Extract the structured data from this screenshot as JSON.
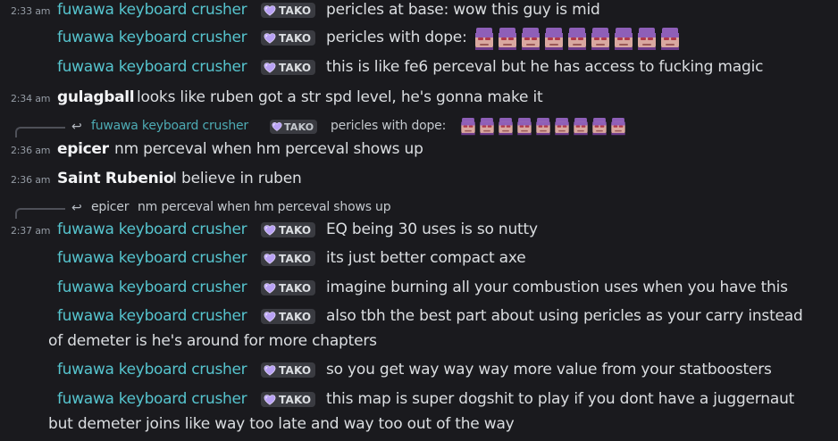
{
  "colors": {
    "background": "#1a1a1e",
    "username_teal": "#56c4ce",
    "username_white": "#f2f3f5",
    "text": "#dbdee1",
    "timestamp": "#949ba4",
    "tag_bg": "#3a3b41",
    "heart": "#b9a2f5"
  },
  "tag": {
    "icon": "purple-heart-icon",
    "label": "TAKO"
  },
  "emote": {
    "icon": "pericles-face-emote"
  },
  "messages": [
    {
      "timestamp": "2:33 am",
      "author": "fuwawa keyboard crusher",
      "text": "pericles at base: wow this guy is mid"
    },
    {
      "author": "fuwawa keyboard crusher",
      "text": "pericles with dope:"
    },
    {
      "author": "fuwawa keyboard crusher",
      "text": "this is like fe6 perceval but he has access to fucking magic"
    },
    {
      "timestamp": "2:34 am",
      "author": "gulagball",
      "text": "looks like ruben got a str spd level, he's gonna make it"
    },
    {
      "reply_to": {
        "author": "fuwawa keyboard crusher",
        "text": "pericles with dope:"
      },
      "timestamp": "2:36 am",
      "author": "epicer",
      "text": "nm perceval when hm perceval shows up"
    },
    {
      "timestamp": "2:36 am",
      "author": "Saint Rubenio",
      "text": "I believe in ruben"
    },
    {
      "reply_to": {
        "author": "epicer",
        "text": "nm perceval when hm perceval shows up"
      },
      "timestamp": "2:37 am",
      "author": "fuwawa keyboard crusher",
      "text": "EQ being 30 uses is so nutty"
    },
    {
      "author": "fuwawa keyboard crusher",
      "text": "its just better compact axe"
    },
    {
      "author": "fuwawa keyboard crusher",
      "text": "imagine burning all your combustion uses when you have this"
    },
    {
      "author": "fuwawa keyboard crusher",
      "text": "also tbh the best part about using pericles as your carry instead",
      "text_cont": "of demeter is he's around for more chapters"
    },
    {
      "author": "fuwawa keyboard crusher",
      "text": "so you get way way way more value from your statboosters"
    },
    {
      "author": "fuwawa keyboard crusher",
      "text": "this map is super dogshit to play if you dont have a juggernaut",
      "text_cont": "but demeter joins like way too late and way too out of the way"
    }
  ]
}
